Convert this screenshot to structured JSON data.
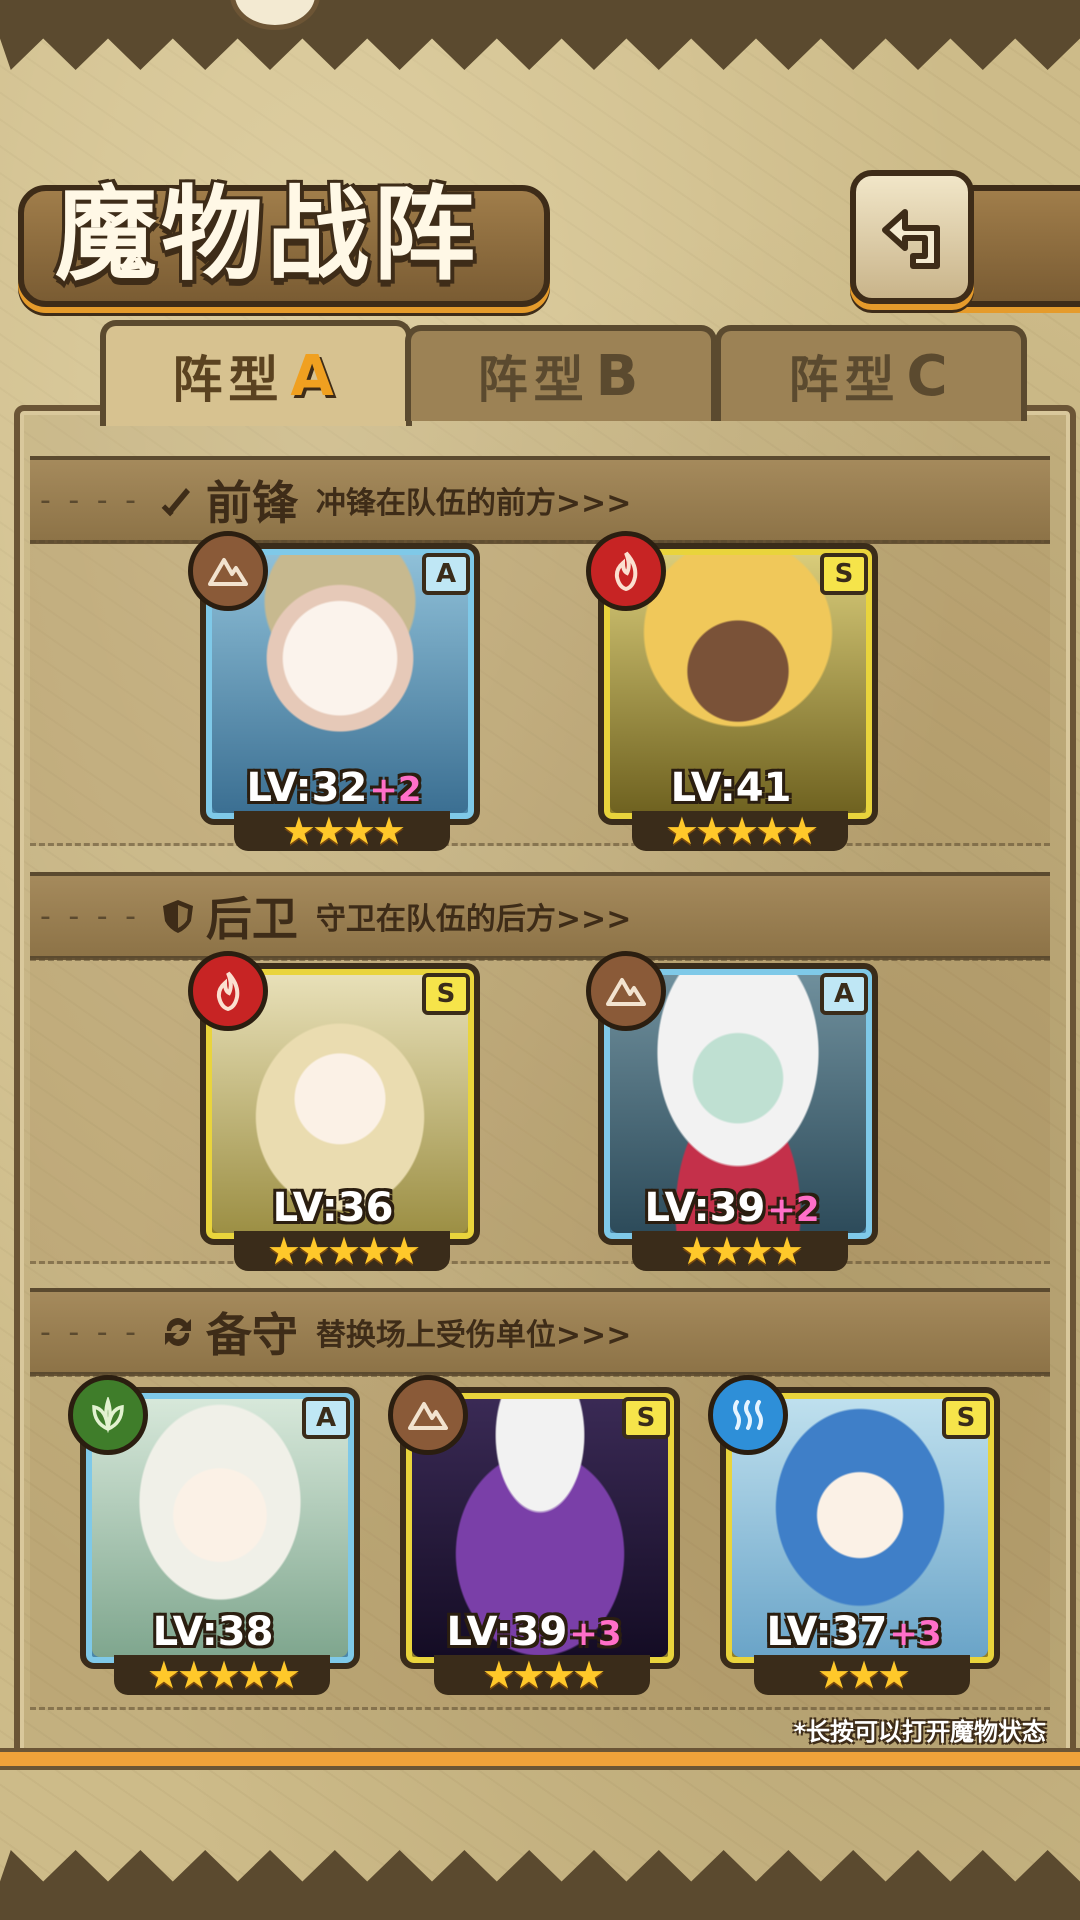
{
  "title": "魔物战阵",
  "tabs": [
    {
      "label": "阵型",
      "letter": "A",
      "active": true
    },
    {
      "label": "阵型",
      "letter": "B",
      "active": false
    },
    {
      "label": "阵型",
      "letter": "C",
      "active": false
    }
  ],
  "sections": {
    "front": {
      "title": "前锋",
      "desc": "冲锋在队伍的前方>>>",
      "icon": "sword-icon"
    },
    "back": {
      "title": "后卫",
      "desc": "守卫在队伍的后方>>>",
      "icon": "shield-icon"
    },
    "reserve": {
      "title": "备守",
      "desc": "替换场上受伤单位>>>",
      "icon": "swap-icon"
    }
  },
  "units": [
    {
      "rank": "A",
      "element": "earth",
      "lv": "LV:32",
      "plus": "+2",
      "stars": "★★★★",
      "star_count": 4
    },
    {
      "rank": "S",
      "element": "fire",
      "lv": "LV:41",
      "plus": "",
      "stars": "★★★★★",
      "star_count": 5
    },
    {
      "rank": "S",
      "element": "fire",
      "lv": "LV:36",
      "plus": "",
      "stars": "★★★★★",
      "star_count": 5
    },
    {
      "rank": "A",
      "element": "earth",
      "lv": "LV:39",
      "plus": "+2",
      "stars": "★★★★",
      "star_count": 4
    },
    {
      "rank": "A",
      "element": "leaf",
      "lv": "LV:38",
      "plus": "",
      "stars": "★★★★★",
      "star_count": 5
    },
    {
      "rank": "S",
      "element": "earth",
      "lv": "LV:39",
      "plus": "+3",
      "stars": "★★★★",
      "star_count": 4
    },
    {
      "rank": "S",
      "element": "water",
      "lv": "LV:37",
      "plus": "+3",
      "stars": "★★★",
      "star_count": 3
    }
  ],
  "hint": "*长按可以打开魔物状态",
  "colors": {
    "accent": "#f0a23a",
    "frame": "#5b4a2f",
    "rank_A": "#7fc9e8",
    "rank_S": "#e9d43c"
  }
}
